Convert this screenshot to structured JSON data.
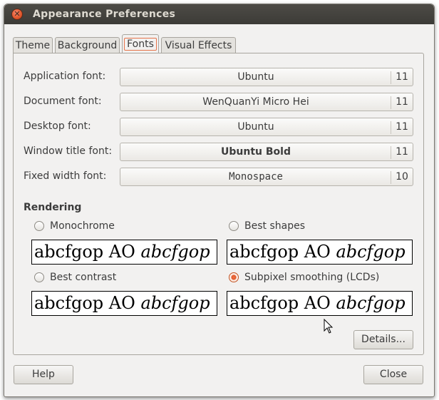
{
  "window": {
    "title": "Appearance Preferences"
  },
  "tabs": [
    {
      "label": "Theme"
    },
    {
      "label": "Background"
    },
    {
      "label": "Fonts",
      "active": true
    },
    {
      "label": "Visual Effects"
    }
  ],
  "fonts": [
    {
      "label": "Application font:",
      "name": "Ubuntu",
      "size": "11"
    },
    {
      "label": "Document font:",
      "name": "WenQuanYi Micro Hei",
      "size": "11"
    },
    {
      "label": "Desktop font:",
      "name": "Ubuntu",
      "size": "11"
    },
    {
      "label": "Window title font:",
      "name": "Ubuntu Bold",
      "size": "11"
    },
    {
      "label": "Fixed width font:",
      "name": "Monospace",
      "size": "10"
    }
  ],
  "rendering": {
    "title": "Rendering",
    "sample_regular": "abcfgop AO ",
    "sample_italic": "abcfgop",
    "options": [
      {
        "label": "Monochrome",
        "checked": false
      },
      {
        "label": "Best shapes",
        "checked": false
      },
      {
        "label": "Best contrast",
        "checked": false
      },
      {
        "label": "Subpixel smoothing (LCDs)",
        "checked": true
      }
    ]
  },
  "buttons": {
    "details": "Details...",
    "help": "Help",
    "close": "Close"
  },
  "colors": {
    "titlebar": "#3c3b37",
    "accent": "#e0562b",
    "window_bg": "#f2f1f0"
  }
}
